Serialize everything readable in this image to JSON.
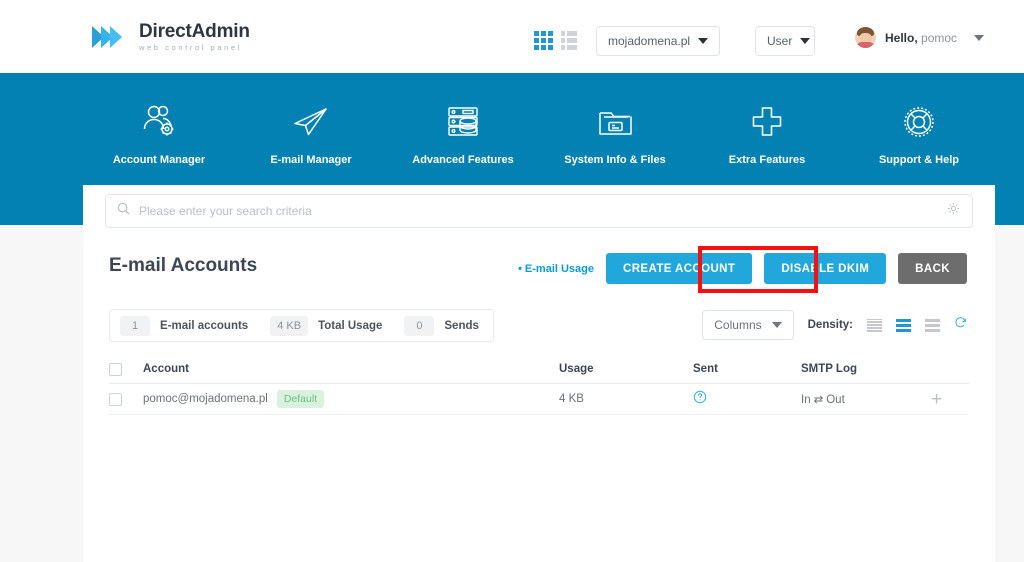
{
  "brand": {
    "title_bold": "Direct",
    "title_rest": "Admin",
    "subtitle": "web control panel",
    "logo_icon": "double-chevron-icon"
  },
  "header": {
    "grid_view_icon": "grid-view-icon",
    "list_view_icon": "list-view-icon",
    "domain_select": {
      "value": "mojadomena.pl",
      "caret_icon": "chevron-down-icon"
    },
    "user_select": {
      "value": "User",
      "caret_icon": "chevron-down-icon"
    },
    "account": {
      "avatar_icon": "user-avatar",
      "greeting": "Hello,",
      "username": "pomoc",
      "caret_icon": "chevron-down-icon"
    }
  },
  "nav": {
    "items": [
      {
        "label": "Account Manager",
        "icon": "users-gear-icon"
      },
      {
        "label": "E-mail Manager",
        "icon": "paper-plane-icon"
      },
      {
        "label": "Advanced Features",
        "icon": "server-database-icon"
      },
      {
        "label": "System Info & Files",
        "icon": "folder-files-icon"
      },
      {
        "label": "Extra Features",
        "icon": "plus-cross-icon"
      },
      {
        "label": "Support & Help",
        "icon": "lifebuoy-icon"
      }
    ],
    "background_color": "#0481b3"
  },
  "search": {
    "placeholder": "Please enter your search criteria",
    "value": "",
    "search_icon": "search-icon",
    "settings_icon": "gear-icon"
  },
  "main": {
    "title": "E-mail Accounts",
    "usage_link": "E-mail Usage",
    "buttons": {
      "create": "CREATE ACCOUNT",
      "dkim": "DISABLE DKIM",
      "back": "BACK"
    },
    "highlight": {
      "target": "create-account-button",
      "color": "#f80f0f"
    }
  },
  "stats": [
    {
      "value": "1",
      "label": "E-mail accounts"
    },
    {
      "value": "4 KB",
      "label": "Total Usage"
    },
    {
      "value": "0",
      "label": "Sends"
    }
  ],
  "tools": {
    "columns_label": "Columns",
    "columns_caret_icon": "chevron-down-icon",
    "density_label": "Density:",
    "density_options": [
      "compact",
      "standard",
      "comfortable"
    ],
    "density_selected": "standard",
    "refresh_icon": "refresh-icon"
  },
  "table": {
    "select_all_checkbox": false,
    "columns": [
      "Account",
      "Usage",
      "Sent",
      "SMTP Log"
    ],
    "rows": [
      {
        "checked": false,
        "account": "pomoc@mojadomena.pl",
        "badge": "Default",
        "usage": "4 KB",
        "sent_icon": "question-circle-icon",
        "smtp_in": "In",
        "smtp_arrows": "⇄",
        "smtp_out": "Out",
        "add_icon": "plus-icon"
      }
    ]
  },
  "colors": {
    "nav_blue": "#0481b3",
    "accent_blue": "#22a7dd",
    "link_blue": "#0b9ad6",
    "back_gray": "#6d6d6d",
    "badge_green_bg": "#d9f2de",
    "badge_green_text": "#6fc180",
    "highlight_red": "#f80f0f",
    "page_bg": "#f7f7f7"
  }
}
